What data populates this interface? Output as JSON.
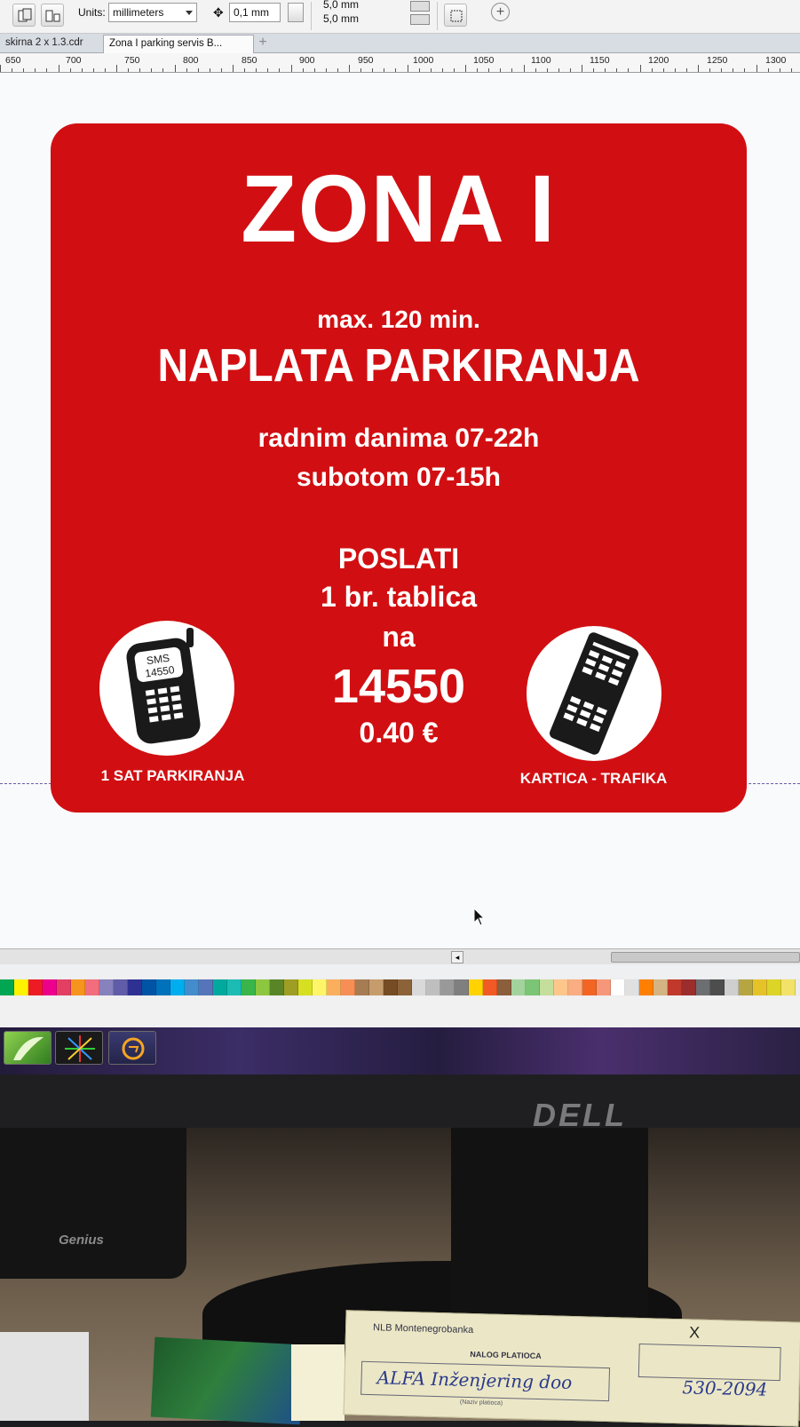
{
  "toolbar": {
    "units_label": "Units:",
    "units_value": "millimeters",
    "nudge_value": "0,1 mm",
    "duplicate_x": "5,0 mm",
    "duplicate_y": "5,0 mm"
  },
  "tabs": [
    {
      "label": "skirna 2 x 1.3.cdr"
    },
    {
      "label": "Zona I parking servis B..."
    }
  ],
  "ruler": {
    "labels": [
      "650",
      "700",
      "750",
      "800",
      "850",
      "900",
      "950",
      "1000",
      "1050",
      "1100",
      "1150",
      "1200",
      "1250",
      "1300"
    ]
  },
  "sign": {
    "title": "ZONA I",
    "max_time": "max. 120 min.",
    "heading": "NAPLATA  PARKIRANJA",
    "weekdays": "radnim  danima 07-22h",
    "saturday": "subotom 07-15h",
    "send": "POSLATI",
    "plate": "1 br. tablica",
    "to": "na",
    "sms_number": "14550",
    "price": "0.40 €",
    "phone_screen_line1": "SMS",
    "phone_screen_line2": "14550",
    "left_label": "1 SAT PARKIRANJA",
    "right_label": "KARTICA - TRAFIKA",
    "colors": {
      "background": "#d10f12",
      "text": "#ffffff",
      "icon": "#1a1a1a"
    }
  },
  "palette": {
    "colors": [
      "#00a651",
      "#fff200",
      "#ed1c24",
      "#ec008c",
      "#e23f63",
      "#f7941d",
      "#f26d7d",
      "#8781bd",
      "#605ca8",
      "#2e3192",
      "#0054a6",
      "#0072bc",
      "#00aeef",
      "#448ccb",
      "#5674b9",
      "#00a99d",
      "#1cbbb4",
      "#39b54a",
      "#8dc63f",
      "#598527",
      "#9e9d24",
      "#d7df23",
      "#fff568",
      "#fbaf5d",
      "#f68e56",
      "#a67c52",
      "#c69c6d",
      "#754c24",
      "#8c6239",
      "#d9d9d9",
      "#bfbfbf",
      "#999999",
      "#7f7f7f",
      "#ffd200",
      "#f15a24",
      "#8b5e3c",
      "#a3d39c",
      "#7cc576",
      "#c4df9b",
      "#fdc68a",
      "#f9ad81",
      "#f26522",
      "#f7977a",
      "#ffffff",
      "#e0e0e0",
      "#ff7f00",
      "#d4b483",
      "#c0392b",
      "#9b2d2d",
      "#6d6e71",
      "#4d4d4d",
      "#cfcfcf",
      "#b5a642",
      "#e6c229",
      "#dcd427",
      "#f3e26a"
    ]
  },
  "environment": {
    "monitor_brand": "DELL",
    "speaker_brand": "Genius",
    "form_bank": "NLB Montenegrobanka",
    "form_title": "NALOG PLATIOCA",
    "form_handwriting_1": "ALFA Inženjering doo",
    "form_handwriting_2": "530-2094",
    "form_field_caption": "(Naziv platioca)",
    "form_mark": "X"
  }
}
